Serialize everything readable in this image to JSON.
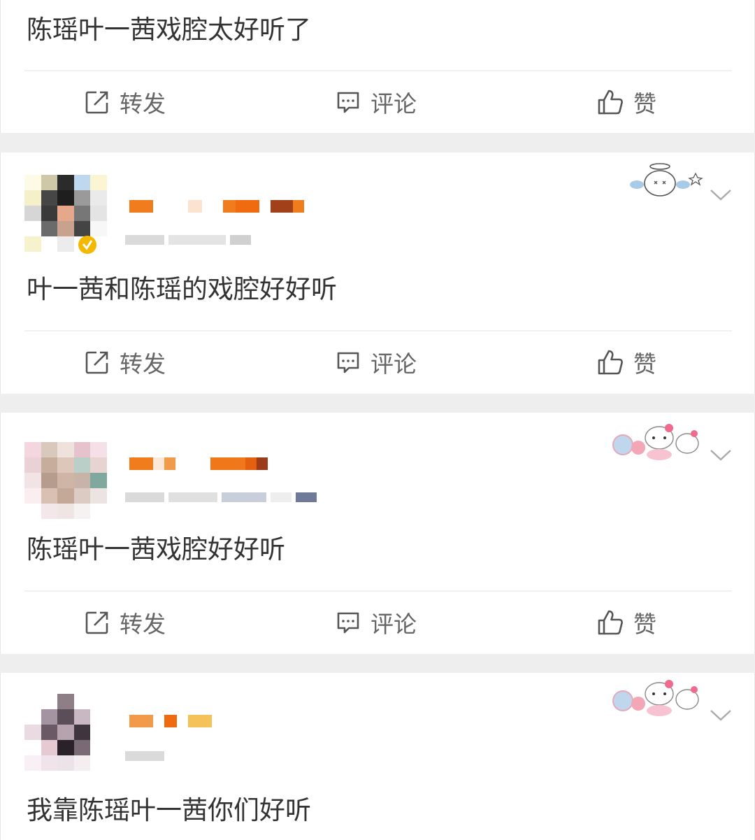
{
  "posts": [
    {
      "text": "陈瑶叶一茜戏腔太好听了"
    },
    {
      "text": "叶一茜和陈瑶的戏腔好好听"
    },
    {
      "text": "陈瑶叶一茜戏腔好好听"
    },
    {
      "text": "我靠陈瑶叶一茜你们好听"
    }
  ],
  "actions": {
    "repost": "转发",
    "comment": "评论",
    "like": "赞"
  },
  "icons": {
    "repost": "repost-icon",
    "comment": "comment-icon",
    "like": "thumbs-up-icon",
    "more": "chevron-down-icon",
    "verified": "verified-badge-icon"
  },
  "colors": {
    "background": "#eeeeee",
    "card": "#ffffff",
    "text": "#333333",
    "action_text": "#666666",
    "username_orange": "#f07c1e",
    "verified": "#f5b800"
  }
}
